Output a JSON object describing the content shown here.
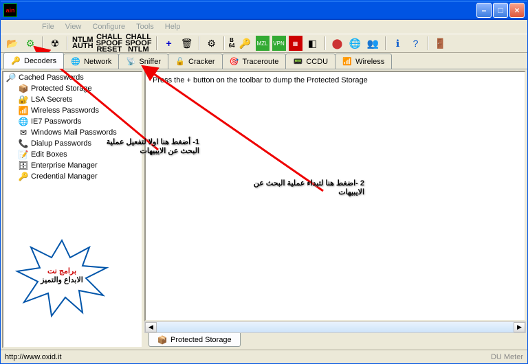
{
  "title": "",
  "app_icon_text": "ain",
  "menubar": [
    "File",
    "View",
    "Configure",
    "Tools",
    "Help"
  ],
  "toolbar_text": {
    "ntlm": "NTLM",
    "auth": "AUTH",
    "spoof": "SPOOF",
    "reset": "RESET",
    "chall": "CHALL",
    "b64": "B\n64"
  },
  "tabs": [
    {
      "label": "Decoders",
      "icon": "🔑"
    },
    {
      "label": "Network",
      "icon": "🌐"
    },
    {
      "label": "Sniffer",
      "icon": "📡"
    },
    {
      "label": "Cracker",
      "icon": "🔓"
    },
    {
      "label": "Traceroute",
      "icon": "🎯"
    },
    {
      "label": "CCDU",
      "icon": "📟"
    },
    {
      "label": "Wireless",
      "icon": "📶"
    }
  ],
  "tree": {
    "root": "Cached Passwords",
    "items": [
      "Protected Storage",
      "LSA Secrets",
      "Wireless Passwords",
      "IE7 Passwords",
      "Windows Mail Passwords",
      "Dialup Passwords",
      "Edit Boxes",
      "Enterprise Manager",
      "Credential Manager"
    ],
    "icons": [
      "📦",
      "🔐",
      "📶",
      "🌐",
      "✉",
      "📞",
      "📝",
      "🗄",
      "🔑"
    ]
  },
  "main_hint": "Press the + button on the toolbar to dump the Protected Storage",
  "bottom_tab": "Protected Storage",
  "status_left": "http://www.oxid.it",
  "status_right": "DU Meter",
  "annot1": "1- أضغط هنا اولا لتفعيل عملية البحث عن الايبيهات",
  "annot2": "2 -اضغط هنا لتبداء عملية البحث عن الايبيهات",
  "star_line1": "برامج نت",
  "star_line2": "الابداع والتميز",
  "win_min": "–",
  "win_max": "□",
  "win_close": "×"
}
